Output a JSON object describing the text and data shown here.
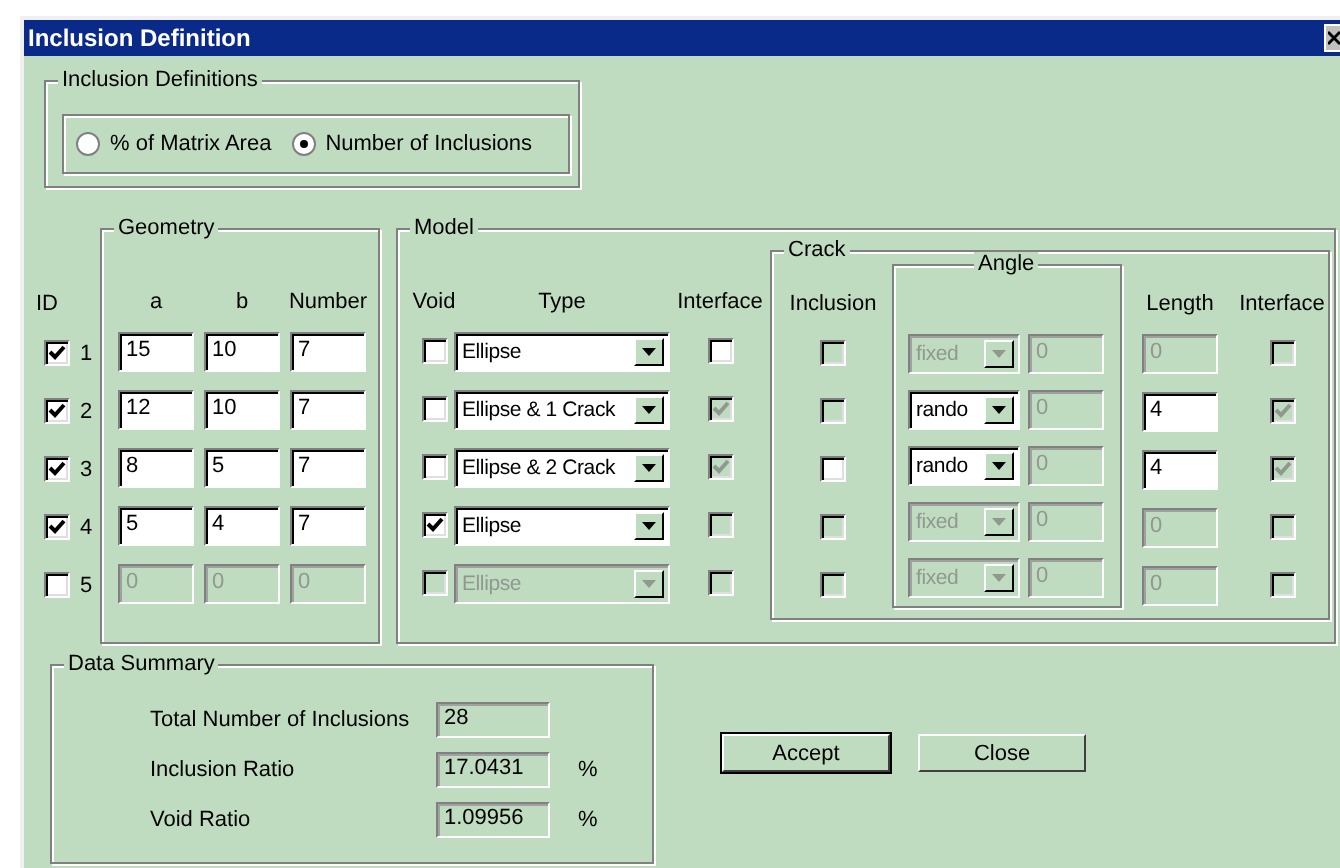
{
  "window": {
    "title": "Inclusion Definition"
  },
  "inclusion_definitions": {
    "title": "Inclusion Definitions",
    "options": [
      {
        "label": "% of Matrix Area",
        "selected": false
      },
      {
        "label": "Number of Inclusions",
        "selected": true
      }
    ]
  },
  "id_header": "ID",
  "geometry": {
    "title": "Geometry",
    "columns": [
      "a",
      "b",
      "Number"
    ]
  },
  "model": {
    "title": "Model",
    "columns": [
      "Void",
      "Type",
      "Interface"
    ]
  },
  "crack": {
    "title": "Crack",
    "inclusion_header": "Inclusion",
    "angle_title": "Angle",
    "length_header": "Length",
    "interface_header": "Interface"
  },
  "rows": [
    {
      "id": "1",
      "checked": true,
      "a": {
        "value": "15",
        "disabled": false
      },
      "b": {
        "value": "10",
        "disabled": false
      },
      "number": {
        "value": "7",
        "disabled": false
      },
      "void": {
        "checked": false,
        "disabled": false
      },
      "type": {
        "value": "Ellipse",
        "disabled": false
      },
      "interface": {
        "checked": false,
        "disabled": false
      },
      "crack_inclusion": {
        "checked": false,
        "disabled": true
      },
      "angle_mode": {
        "value": "fixed",
        "disabled": true
      },
      "angle": {
        "value": "0",
        "disabled": true
      },
      "length": {
        "value": "0",
        "disabled": true
      },
      "crack_interface": {
        "checked": false,
        "disabled": true
      }
    },
    {
      "id": "2",
      "checked": true,
      "a": {
        "value": "12",
        "disabled": false
      },
      "b": {
        "value": "10",
        "disabled": false
      },
      "number": {
        "value": "7",
        "disabled": false
      },
      "void": {
        "checked": false,
        "disabled": false
      },
      "type": {
        "value": "Ellipse & 1 Crack",
        "disabled": false
      },
      "interface": {
        "checked": true,
        "disabled": true
      },
      "crack_inclusion": {
        "checked": false,
        "disabled": true
      },
      "angle_mode": {
        "value": "rando",
        "disabled": false
      },
      "angle": {
        "value": "0",
        "disabled": true
      },
      "length": {
        "value": "4",
        "disabled": false
      },
      "crack_interface": {
        "checked": true,
        "disabled": true
      }
    },
    {
      "id": "3",
      "checked": true,
      "a": {
        "value": "8",
        "disabled": false
      },
      "b": {
        "value": "5",
        "disabled": false
      },
      "number": {
        "value": "7",
        "disabled": false
      },
      "void": {
        "checked": false,
        "disabled": false
      },
      "type": {
        "value": "Ellipse & 2 Crack",
        "disabled": false
      },
      "interface": {
        "checked": true,
        "disabled": true
      },
      "crack_inclusion": {
        "checked": false,
        "disabled": false
      },
      "angle_mode": {
        "value": "rando",
        "disabled": false
      },
      "angle": {
        "value": "0",
        "disabled": true
      },
      "length": {
        "value": "4",
        "disabled": false
      },
      "crack_interface": {
        "checked": true,
        "disabled": true
      }
    },
    {
      "id": "4",
      "checked": true,
      "a": {
        "value": "5",
        "disabled": false
      },
      "b": {
        "value": "4",
        "disabled": false
      },
      "number": {
        "value": "7",
        "disabled": false
      },
      "void": {
        "checked": true,
        "disabled": false
      },
      "type": {
        "value": "Ellipse",
        "disabled": false
      },
      "interface": {
        "checked": false,
        "disabled": true
      },
      "crack_inclusion": {
        "checked": false,
        "disabled": true
      },
      "angle_mode": {
        "value": "fixed",
        "disabled": true
      },
      "angle": {
        "value": "0",
        "disabled": true
      },
      "length": {
        "value": "0",
        "disabled": true
      },
      "crack_interface": {
        "checked": false,
        "disabled": true
      }
    },
    {
      "id": "5",
      "checked": false,
      "a": {
        "value": "0",
        "disabled": true
      },
      "b": {
        "value": "0",
        "disabled": true
      },
      "number": {
        "value": "0",
        "disabled": true
      },
      "void": {
        "checked": false,
        "disabled": true
      },
      "type": {
        "value": "Ellipse",
        "disabled": true
      },
      "interface": {
        "checked": false,
        "disabled": true
      },
      "crack_inclusion": {
        "checked": false,
        "disabled": true
      },
      "angle_mode": {
        "value": "fixed",
        "disabled": true
      },
      "angle": {
        "value": "0",
        "disabled": true
      },
      "length": {
        "value": "0",
        "disabled": true
      },
      "crack_interface": {
        "checked": false,
        "disabled": true
      }
    }
  ],
  "data_summary": {
    "title": "Data Summary",
    "items": [
      {
        "label": "Total Number of Inclusions",
        "value": "28"
      },
      {
        "label": "Inclusion Ratio",
        "value": "17.0431",
        "unit": "%"
      },
      {
        "label": "Void Ratio",
        "value": "1.09956",
        "unit": "%"
      }
    ]
  },
  "buttons": [
    {
      "label": "Accept",
      "default": true
    },
    {
      "label": "Close",
      "default": false
    }
  ]
}
